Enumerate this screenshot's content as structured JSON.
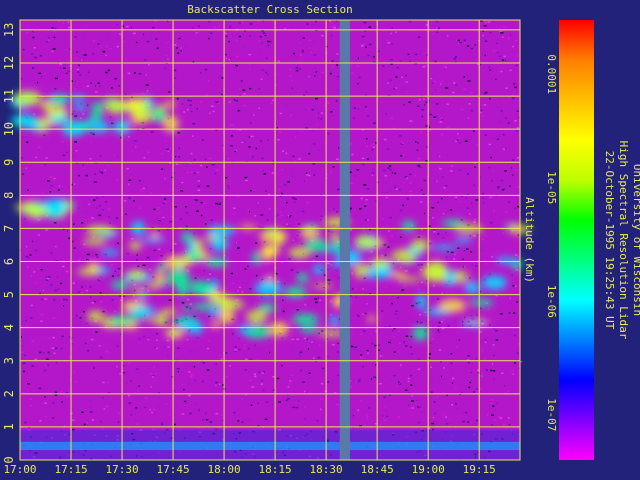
{
  "chart_data": {
    "type": "heatmap",
    "title": "Backscatter Cross Section",
    "xlabel": "",
    "ylabel": "Altitude (km)",
    "x_ticks": [
      "17:00",
      "17:15",
      "17:30",
      "17:45",
      "18:00",
      "18:15",
      "18:30",
      "18:45",
      "19:00",
      "19:15"
    ],
    "x_range": [
      "17:00",
      "19:27"
    ],
    "y_ticks": [
      "0",
      "1",
      "2",
      "3",
      "4",
      "5",
      "6",
      "7",
      "8",
      "9",
      "10",
      "11",
      "12",
      "13"
    ],
    "y_range": [
      0,
      13.3
    ],
    "grid": true,
    "colorbar": {
      "scale": "log",
      "range": [
        4e-08,
        0.0003
      ],
      "ticks": [
        "0.0001",
        "1e-05",
        "1e-06",
        "1e-07"
      ],
      "colors": [
        "#ff00ff",
        "#7f00ff",
        "#0000ff",
        "#0080ff",
        "#00ffff",
        "#00ff7f",
        "#00ff00",
        "#bfff00",
        "#ffff00",
        "#ffbf00",
        "#ff7f00",
        "#ff0000"
      ]
    },
    "data_gap": [
      "18:34",
      "18:37"
    ],
    "features": [
      {
        "name": "cirrus layer",
        "time": [
          "17:00",
          "17:45"
        ],
        "altitude_km": [
          10.0,
          11.0
        ]
      },
      {
        "name": "thin layer",
        "time": [
          "17:02",
          "17:12"
        ],
        "altitude_km": [
          7.5,
          7.7
        ]
      },
      {
        "name": "mid-level cloud",
        "time": [
          "17:20",
          "19:27"
        ],
        "altitude_km": [
          3.8,
          7.2
        ]
      }
    ]
  },
  "annotation": {
    "line1": "University of Wisconsin",
    "line2": "High Spectral Resolution Lidar",
    "line3": "22-October-1995 19:25:43 UT"
  },
  "colors": {
    "background": "#22227a",
    "grid": "#e8e85a",
    "gap": "#5a78a8",
    "text": "#e8e85a"
  }
}
